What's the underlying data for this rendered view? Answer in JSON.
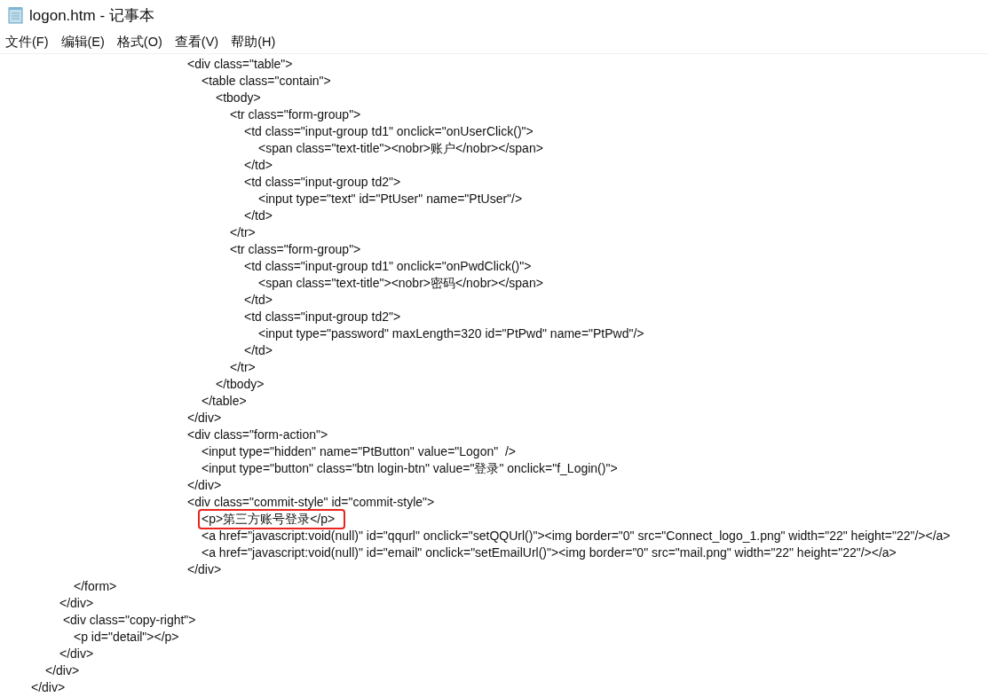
{
  "window": {
    "title": "logon.htm - 记事本"
  },
  "menu": [
    "文件(F)",
    "编辑(E)",
    "格式(O)",
    "查看(V)",
    "帮助(H)"
  ],
  "lines": [
    {
      "text": "\t\t\t\t\t\t\t\t\t\t\t<div class=\"table\">",
      "highlighted": false
    },
    {
      "text": "\t\t\t\t\t\t\t\t\t\t\t\t<table class=\"contain\">",
      "highlighted": false
    },
    {
      "text": "\t\t\t\t\t\t\t\t\t\t\t\t\t<tbody>",
      "highlighted": false
    },
    {
      "text": "\t\t\t\t\t\t\t\t\t\t\t\t\t\t<tr class=\"form-group\">",
      "highlighted": false
    },
    {
      "text": "\t\t\t\t\t\t\t\t\t\t\t\t\t\t\t<td class=\"input-group td1\" onclick=\"onUserClick()\">",
      "highlighted": false
    },
    {
      "text": "\t\t\t\t\t\t\t\t\t\t\t\t\t\t\t\t<span class=\"text-title\"><nobr>账户</nobr></span>",
      "highlighted": false
    },
    {
      "text": "\t\t\t\t\t\t\t\t\t\t\t\t\t\t\t</td>",
      "highlighted": false
    },
    {
      "text": "\t\t\t\t\t\t\t\t\t\t\t\t\t\t\t<td class=\"input-group td2\">",
      "highlighted": false
    },
    {
      "text": "\t\t\t\t\t\t\t\t\t\t\t\t\t\t\t\t<input type=\"text\" id=\"PtUser\" name=\"PtUser\"/>",
      "highlighted": false
    },
    {
      "text": "\t\t\t\t\t\t\t\t\t\t\t\t\t\t\t</td>",
      "highlighted": false
    },
    {
      "text": "\t\t\t\t\t\t\t\t\t\t\t\t\t\t</tr>",
      "highlighted": false
    },
    {
      "text": "\t\t\t\t\t\t\t\t\t\t\t\t\t\t<tr class=\"form-group\">",
      "highlighted": false
    },
    {
      "text": "\t\t\t\t\t\t\t\t\t\t\t\t\t\t\t<td class=\"input-group td1\" onclick=\"onPwdClick()\">",
      "highlighted": false
    },
    {
      "text": "\t\t\t\t\t\t\t\t\t\t\t\t\t\t\t\t<span class=\"text-title\"><nobr>密码</nobr></span>",
      "highlighted": false
    },
    {
      "text": "\t\t\t\t\t\t\t\t\t\t\t\t\t\t\t</td>",
      "highlighted": false
    },
    {
      "text": "\t\t\t\t\t\t\t\t\t\t\t\t\t\t\t<td class=\"input-group td2\">",
      "highlighted": false
    },
    {
      "text": "\t\t\t\t\t\t\t\t\t\t\t\t\t\t\t\t<input type=\"password\" maxLength=320 id=\"PtPwd\" name=\"PtPwd\"/>",
      "highlighted": false
    },
    {
      "text": "\t\t\t\t\t\t\t\t\t\t\t\t\t\t\t</td>",
      "highlighted": false
    },
    {
      "text": "\t\t\t\t\t\t\t\t\t\t\t\t\t\t</tr>",
      "highlighted": false
    },
    {
      "text": "\t\t\t\t\t\t\t\t\t\t\t\t\t</tbody>",
      "highlighted": false
    },
    {
      "text": "\t\t\t\t\t\t\t\t\t\t\t\t</table>",
      "highlighted": false
    },
    {
      "text": "\t\t\t\t\t\t\t\t\t\t\t</div>",
      "highlighted": false
    },
    {
      "text": "\t\t\t\t\t\t\t\t\t\t\t<div class=\"form-action\">",
      "highlighted": false
    },
    {
      "text": "\t\t\t\t\t\t\t\t\t\t\t\t<input type=\"hidden\" name=\"PtButton\" value=\"Logon\"  />",
      "highlighted": false
    },
    {
      "text": "\t\t\t\t\t\t\t\t\t\t\t\t<input type=\"button\" class=\"btn login-btn\" value=\"登录\" onclick=\"f_Login()\">",
      "highlighted": false
    },
    {
      "text": "\t\t\t\t\t\t\t\t\t\t\t</div>",
      "highlighted": false
    },
    {
      "text": "\t\t\t\t\t\t\t\t\t\t\t<div class=\"commit-style\" id=\"commit-style\">",
      "highlighted": false
    },
    {
      "text": "\t\t\t\t\t\t\t\t\t\t\t\t<p>第三方账号登录</p>",
      "highlighted": true
    },
    {
      "text": "\t\t\t\t\t\t\t\t\t\t\t\t<a href=\"javascript:void(null)\" id=\"qqurl\" onclick=\"setQQUrl()\"><img border=\"0\" src=\"Connect_logo_1.png\" width=\"22\" height=\"22\"/></a>",
      "highlighted": false
    },
    {
      "text": "\t\t\t\t\t\t\t\t\t\t\t\t<a href=\"javascript:void(null)\" id=\"email\" onclick=\"setEmailUrl()\"><img border=\"0\" src=\"mail.png\" width=\"22\" height=\"22\"/></a>",
      "highlighted": false
    },
    {
      "text": "\t\t\t\t\t\t\t\t\t\t\t</div>",
      "highlighted": false
    },
    {
      "text": "\t\t\t</form>",
      "highlighted": false
    },
    {
      "text": "\t\t</div>",
      "highlighted": false
    },
    {
      "text": "\t\t <div class=\"copy-right\">",
      "highlighted": false
    },
    {
      "text": "\t\t\t<p id=\"detail\"></p>",
      "highlighted": false
    },
    {
      "text": "\t\t</div>",
      "highlighted": false
    },
    {
      "text": "\t</div>",
      "highlighted": false
    },
    {
      "text": "</div>",
      "highlighted": false
    }
  ]
}
